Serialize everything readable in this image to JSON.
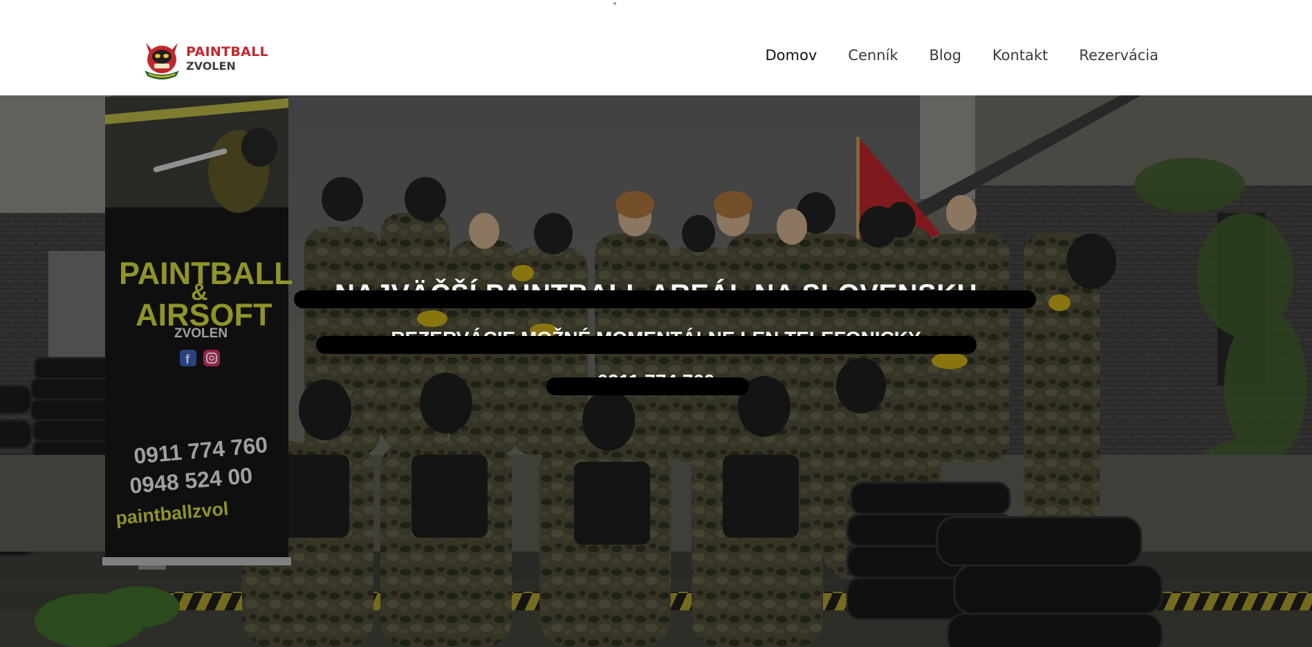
{
  "brand": {
    "line1": "PAINTBALL",
    "line2": "ZVOLEN",
    "colors": {
      "red": "#c4262e",
      "gray": "#3e3e3e"
    }
  },
  "nav": {
    "items": [
      {
        "label": "Domov",
        "active": true
      },
      {
        "label": "Cenník",
        "active": false
      },
      {
        "label": "Blog",
        "active": false
      },
      {
        "label": "Kontakt",
        "active": false
      },
      {
        "label": "Rezervácia",
        "active": false
      }
    ]
  },
  "hero": {
    "headline": "NAJVÄČŠÍ PAINTBALL AREÁL NA SLOVENSKU",
    "subline": "REZERVÁCIE MOŽNÉ MOMENTÁLNE LEN TELEFONICKY",
    "phone": "0911 774 760",
    "overlay_color": "#000000",
    "banner": {
      "title_line1": "PAINTBALL",
      "amp": "&",
      "title_line2": "AIRSOFT",
      "subtitle": "ZVOLEN",
      "phone1": "0911 774 760",
      "phone2": "0948 524 00",
      "web": "paintballzvol",
      "icons": [
        "facebook-icon",
        "instagram-icon"
      ]
    }
  }
}
